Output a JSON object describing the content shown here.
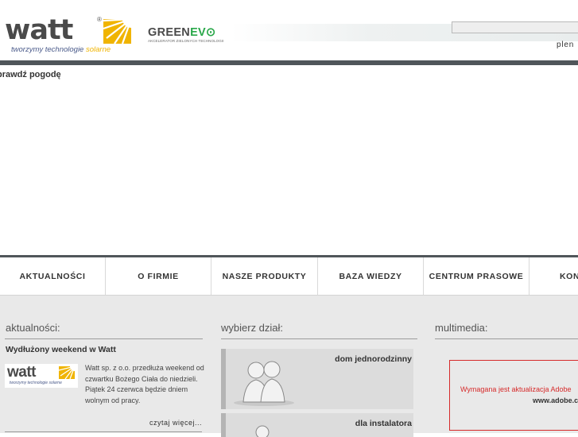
{
  "header": {
    "brand": "watt",
    "tagline_main": "tworzymy technologie ",
    "tagline_highlight": "solarne",
    "partner_brand_main": "GREEN",
    "partner_brand_accent": "EV",
    "partner_tagline": "AKCELERATOR ZIELONYCH TECHNOLOGII",
    "search_value": "",
    "lang_link": "plen",
    "weather_link": "prawdź pogodę"
  },
  "nav": {
    "items": [
      {
        "label": "AKTUALNOŚCI"
      },
      {
        "label": "O FIRMIE"
      },
      {
        "label": "NASZE PRODUKTY"
      },
      {
        "label": "BAZA WIEDZY"
      },
      {
        "label": "CENTRUM PRASOWE"
      },
      {
        "label": "KON"
      }
    ]
  },
  "news": {
    "heading": "aktualności:",
    "title": "Wydłużony weekend w Watt",
    "thumb_brand": "watt",
    "thumb_tagline": "tworzymy technologie solarne",
    "body": "Watt sp. z o.o. przedłuża weekend od czwartku Bożego Ciała do niedzieli. Piątek 24 czerwca będzie dniem wolnym od pracy.",
    "more_link": "czytaj więcej..."
  },
  "sections": {
    "heading": "wybierz dział:",
    "items": [
      {
        "label": "dom jednorodzinny"
      },
      {
        "label": "dla instalatora"
      }
    ]
  },
  "multimedia": {
    "heading": "multimedia:",
    "flash_message": "Wymagana jest aktualizacja Adobe",
    "flash_link": "www.adobe.c"
  },
  "colors": {
    "header_bar": "#50565a",
    "brand_yellow": "#f0b400",
    "greenevo_green": "#2aa84a",
    "content_bg": "#e9e9e9",
    "alert_red": "#d62a2a"
  }
}
